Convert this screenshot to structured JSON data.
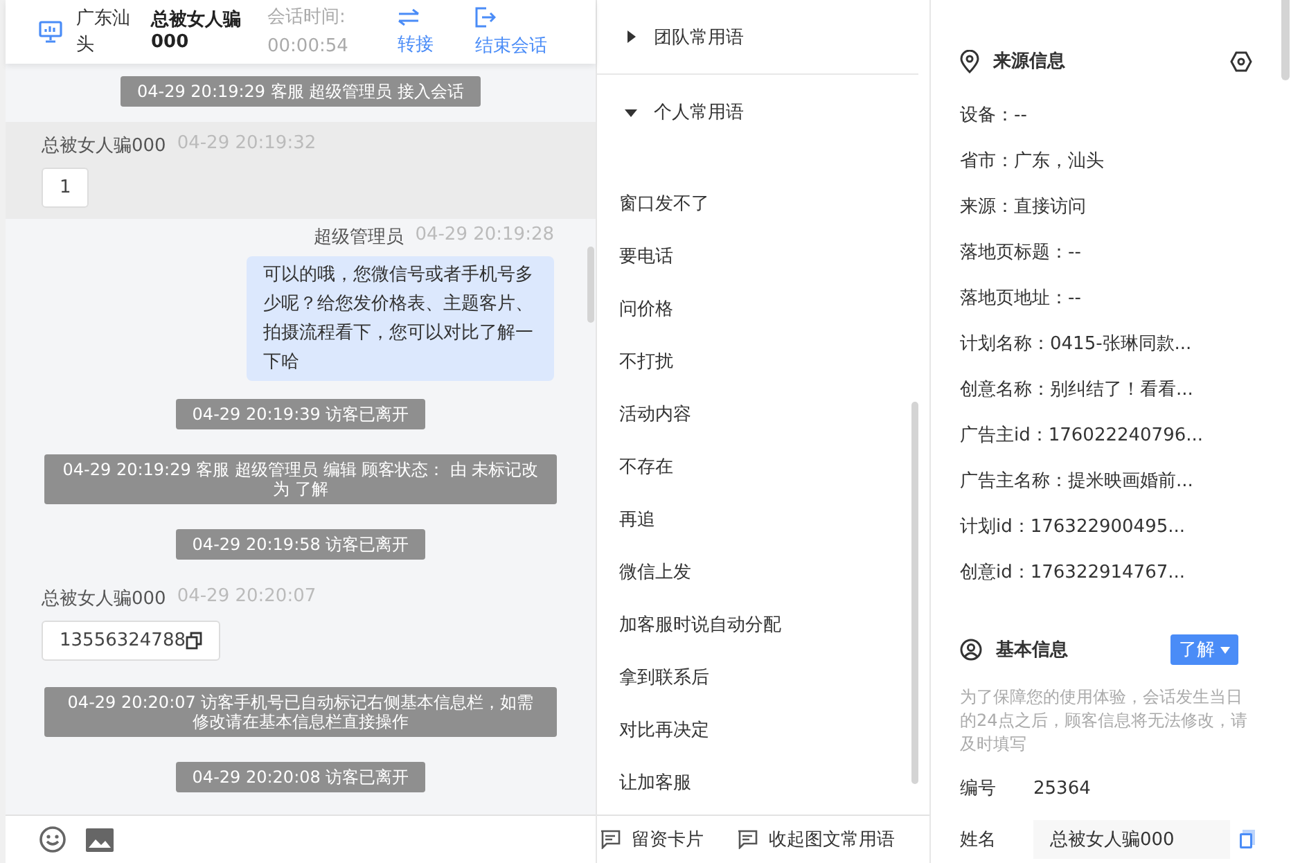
{
  "header": {
    "location": "广东汕头",
    "visitor_name": "总被女人骗000",
    "timer_label": "会话时间:",
    "timer": "00:00:54",
    "actions": [
      {
        "kind": "transfer",
        "label": "转接"
      },
      {
        "kind": "end",
        "label": "结束会话"
      }
    ]
  },
  "messages": [
    {
      "kind": "system",
      "text": "04-29 20:19:29 客服 超级管理员 接入会话"
    },
    {
      "kind": "visitor",
      "sender": "总被女人骗000",
      "time": "04-29 20:19:32",
      "text": "1",
      "highlighted": true,
      "copyable": false
    },
    {
      "kind": "agent",
      "sender": "超级管理员",
      "time": "04-29 20:19:28",
      "text": "可以的哦，您微信号或者手机号多少呢？给您发价格表、主题客片、拍摄流程看下，您可以对比了解一下哈"
    },
    {
      "kind": "system",
      "text": "04-29 20:19:39 访客已离开"
    },
    {
      "kind": "system",
      "text": "04-29 20:19:29 客服 超级管理员 编辑 顾客状态： 由 未标记改为 了解"
    },
    {
      "kind": "system",
      "text": "04-29 20:19:58 访客已离开"
    },
    {
      "kind": "visitor",
      "sender": "总被女人骗000",
      "time": "04-29 20:20:07",
      "text": "13556324788",
      "highlighted": false,
      "copyable": true
    },
    {
      "kind": "system",
      "text": "04-29 20:20:07 访客手机号已自动标记右侧基本信息栏，如需修改请在基本信息栏直接操作"
    },
    {
      "kind": "system",
      "text": "04-29 20:20:08 访客已离开"
    }
  ],
  "phrases": {
    "groups": [
      {
        "label": "团队常用语",
        "expanded": false
      },
      {
        "label": "个人常用语",
        "expanded": true,
        "items": [
          "窗口发不了",
          "要电话",
          "问价格",
          "不打扰",
          "活动内容",
          "不存在",
          "再追",
          "微信上发",
          "加客服时说自动分配",
          "拿到联系后",
          "对比再决定",
          "让加客服"
        ]
      }
    ]
  },
  "bottom_actions": [
    "留资卡片",
    "收起图文常用语"
  ],
  "source_info": {
    "title": "来源信息",
    "rows": [
      "设备：--",
      "省市：广东，汕头",
      "来源：直接访问",
      "落地页标题：--",
      "落地页地址：--",
      "计划名称：0415-张琳同款...",
      "创意名称：别纠结了！看看...",
      "广告主id：176022240796...",
      "广告主名称：提米映画婚前...",
      "计划id：176322900495...",
      "创意id：176322914767..."
    ]
  },
  "basic_info": {
    "title": "基本信息",
    "status": "了解",
    "note": "为了保障您的使用体验，会话发生当日的24点之后，顾客信息将无法修改，请及时填写",
    "fields": [
      {
        "kind": "text",
        "label": "编号",
        "value": "25364"
      },
      {
        "kind": "input",
        "label": "姓名",
        "value": "总被女人骗000"
      }
    ]
  }
}
